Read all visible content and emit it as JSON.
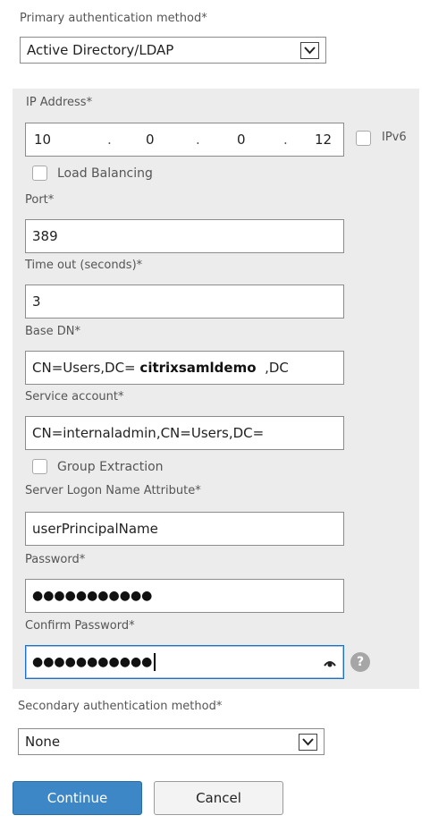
{
  "primary": {
    "label": "Primary authentication method*",
    "selected": "Active Directory/LDAP"
  },
  "ldap": {
    "ip_label": "IP Address*",
    "ip_octets": [
      "10",
      "0",
      "0",
      "12"
    ],
    "ip_separator": ".",
    "ipv6_label": "IPv6",
    "load_balancing_label": "Load Balancing",
    "port_label": "Port*",
    "port_value": "389",
    "timeout_label": "Time out (seconds)*",
    "timeout_value": "3",
    "base_dn_label": "Base DN*",
    "base_dn_prefix": "CN=Users,DC=",
    "base_dn_highlight": "citrixsamldemo",
    "base_dn_suffix": ",DC",
    "service_account_label": "Service account*",
    "service_account_value": "CN=internaladmin,CN=Users,DC=",
    "group_extraction_label": "Group Extraction",
    "logon_attr_label": "Server Logon Name Attribute*",
    "logon_attr_value": "userPrincipalName",
    "password_label": "Password*",
    "password_mask": "●●●●●●●●●●●",
    "confirm_label": "Confirm Password*",
    "confirm_mask": "●●●●●●●●●●●",
    "help_glyph": "?"
  },
  "secondary": {
    "label": "Secondary authentication method*",
    "selected": "None"
  },
  "actions": {
    "continue_label": "Continue",
    "cancel_label": "Cancel"
  },
  "colors": {
    "primary_button": "#3d87c6",
    "panel": "#ececec",
    "focus": "#1f6fc3"
  }
}
